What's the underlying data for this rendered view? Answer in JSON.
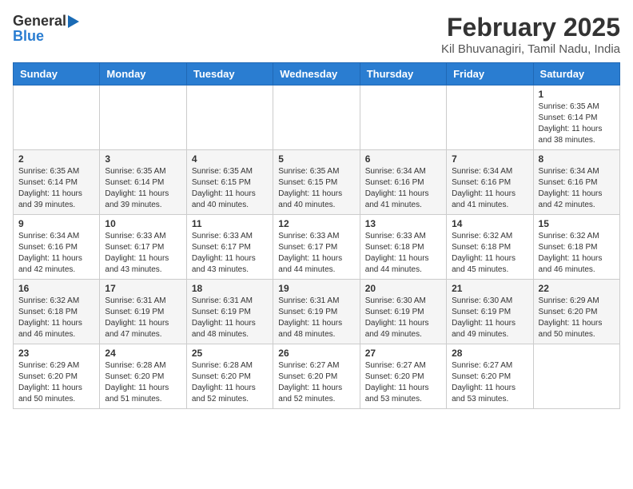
{
  "logo": {
    "line1": "General",
    "line2": "Blue"
  },
  "title": "February 2025",
  "subtitle": "Kil Bhuvanagiri, Tamil Nadu, India",
  "weekdays": [
    "Sunday",
    "Monday",
    "Tuesday",
    "Wednesday",
    "Thursday",
    "Friday",
    "Saturday"
  ],
  "weeks": [
    [
      {
        "day": "",
        "info": ""
      },
      {
        "day": "",
        "info": ""
      },
      {
        "day": "",
        "info": ""
      },
      {
        "day": "",
        "info": ""
      },
      {
        "day": "",
        "info": ""
      },
      {
        "day": "",
        "info": ""
      },
      {
        "day": "1",
        "info": "Sunrise: 6:35 AM\nSunset: 6:14 PM\nDaylight: 11 hours and 38 minutes."
      }
    ],
    [
      {
        "day": "2",
        "info": "Sunrise: 6:35 AM\nSunset: 6:14 PM\nDaylight: 11 hours and 39 minutes."
      },
      {
        "day": "3",
        "info": "Sunrise: 6:35 AM\nSunset: 6:14 PM\nDaylight: 11 hours and 39 minutes."
      },
      {
        "day": "4",
        "info": "Sunrise: 6:35 AM\nSunset: 6:15 PM\nDaylight: 11 hours and 40 minutes."
      },
      {
        "day": "5",
        "info": "Sunrise: 6:35 AM\nSunset: 6:15 PM\nDaylight: 11 hours and 40 minutes."
      },
      {
        "day": "6",
        "info": "Sunrise: 6:34 AM\nSunset: 6:16 PM\nDaylight: 11 hours and 41 minutes."
      },
      {
        "day": "7",
        "info": "Sunrise: 6:34 AM\nSunset: 6:16 PM\nDaylight: 11 hours and 41 minutes."
      },
      {
        "day": "8",
        "info": "Sunrise: 6:34 AM\nSunset: 6:16 PM\nDaylight: 11 hours and 42 minutes."
      }
    ],
    [
      {
        "day": "9",
        "info": "Sunrise: 6:34 AM\nSunset: 6:16 PM\nDaylight: 11 hours and 42 minutes."
      },
      {
        "day": "10",
        "info": "Sunrise: 6:33 AM\nSunset: 6:17 PM\nDaylight: 11 hours and 43 minutes."
      },
      {
        "day": "11",
        "info": "Sunrise: 6:33 AM\nSunset: 6:17 PM\nDaylight: 11 hours and 43 minutes."
      },
      {
        "day": "12",
        "info": "Sunrise: 6:33 AM\nSunset: 6:17 PM\nDaylight: 11 hours and 44 minutes."
      },
      {
        "day": "13",
        "info": "Sunrise: 6:33 AM\nSunset: 6:18 PM\nDaylight: 11 hours and 44 minutes."
      },
      {
        "day": "14",
        "info": "Sunrise: 6:32 AM\nSunset: 6:18 PM\nDaylight: 11 hours and 45 minutes."
      },
      {
        "day": "15",
        "info": "Sunrise: 6:32 AM\nSunset: 6:18 PM\nDaylight: 11 hours and 46 minutes."
      }
    ],
    [
      {
        "day": "16",
        "info": "Sunrise: 6:32 AM\nSunset: 6:18 PM\nDaylight: 11 hours and 46 minutes."
      },
      {
        "day": "17",
        "info": "Sunrise: 6:31 AM\nSunset: 6:19 PM\nDaylight: 11 hours and 47 minutes."
      },
      {
        "day": "18",
        "info": "Sunrise: 6:31 AM\nSunset: 6:19 PM\nDaylight: 11 hours and 48 minutes."
      },
      {
        "day": "19",
        "info": "Sunrise: 6:31 AM\nSunset: 6:19 PM\nDaylight: 11 hours and 48 minutes."
      },
      {
        "day": "20",
        "info": "Sunrise: 6:30 AM\nSunset: 6:19 PM\nDaylight: 11 hours and 49 minutes."
      },
      {
        "day": "21",
        "info": "Sunrise: 6:30 AM\nSunset: 6:19 PM\nDaylight: 11 hours and 49 minutes."
      },
      {
        "day": "22",
        "info": "Sunrise: 6:29 AM\nSunset: 6:20 PM\nDaylight: 11 hours and 50 minutes."
      }
    ],
    [
      {
        "day": "23",
        "info": "Sunrise: 6:29 AM\nSunset: 6:20 PM\nDaylight: 11 hours and 50 minutes."
      },
      {
        "day": "24",
        "info": "Sunrise: 6:28 AM\nSunset: 6:20 PM\nDaylight: 11 hours and 51 minutes."
      },
      {
        "day": "25",
        "info": "Sunrise: 6:28 AM\nSunset: 6:20 PM\nDaylight: 11 hours and 52 minutes."
      },
      {
        "day": "26",
        "info": "Sunrise: 6:27 AM\nSunset: 6:20 PM\nDaylight: 11 hours and 52 minutes."
      },
      {
        "day": "27",
        "info": "Sunrise: 6:27 AM\nSunset: 6:20 PM\nDaylight: 11 hours and 53 minutes."
      },
      {
        "day": "28",
        "info": "Sunrise: 6:27 AM\nSunset: 6:20 PM\nDaylight: 11 hours and 53 minutes."
      },
      {
        "day": "",
        "info": ""
      }
    ]
  ]
}
